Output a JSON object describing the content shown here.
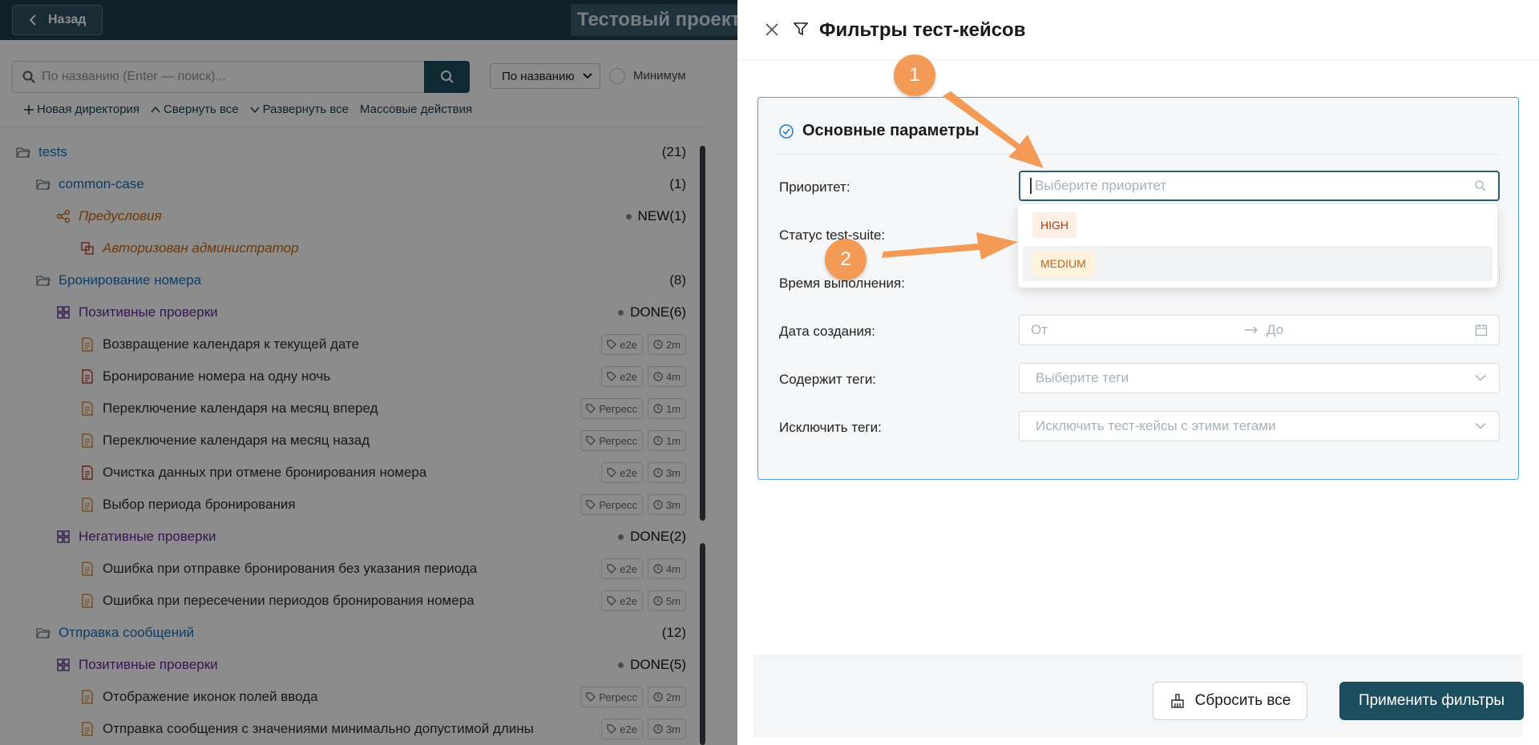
{
  "app": {
    "back_label": "Назад",
    "project_title": "Тестовый проект"
  },
  "search": {
    "placeholder": "По названию (Enter — поиск)...",
    "sort_value": "По названию",
    "min_label": "Минимум"
  },
  "toolbar": {
    "new_dir": "Новая директория",
    "collapse_all": "Свернуть все",
    "expand_all": "Развернуть все",
    "mass_actions": "Массовые действия"
  },
  "tree": {
    "rows": [
      {
        "label": "tests",
        "count": "(21)"
      },
      {
        "label": "common-case",
        "count": "(1)"
      },
      {
        "label": "Предусловия",
        "status": "NEW",
        "count": "(1)"
      },
      {
        "label": "Авторизован администратор"
      },
      {
        "label": "Бронирование номера",
        "count": "(8)"
      },
      {
        "label": "Позитивные проверки",
        "status": "DONE",
        "count": "(6)"
      },
      {
        "label": "Возвращение календаря к текущей дате",
        "tag": "e2e",
        "time": "2m"
      },
      {
        "label": "Бронирование номера на одну ночь",
        "tag": "e2e",
        "time": "4m"
      },
      {
        "label": "Переключение календаря на месяц вперед",
        "tag": "Регресс",
        "time": "1m"
      },
      {
        "label": "Переключение календаря на месяц назад",
        "tag": "Регресс",
        "time": "1m"
      },
      {
        "label": "Очистка данных при отмене бронирования номера",
        "tag": "e2e",
        "time": "3m"
      },
      {
        "label": "Выбор периода бронирования",
        "tag": "Регресс",
        "time": "3m"
      },
      {
        "label": "Негативные проверки",
        "status": "DONE",
        "count": "(2)"
      },
      {
        "label": "Ошибка при отправке бронирования без указания периода",
        "tag": "e2e",
        "time": "4m"
      },
      {
        "label": "Ошибка при пересечении периодов бронирования номера",
        "tag": "e2e",
        "time": "5m"
      },
      {
        "label": "Отправка сообщений",
        "count": "(12)"
      },
      {
        "label": "Позитивные проверки",
        "status": "DONE",
        "count": "(5)"
      },
      {
        "label": "Отображение иконок полей ввода",
        "tag": "Регресс",
        "time": "2m"
      },
      {
        "label": "Отправка сообщения с значениями минимально допустимой длины",
        "tag": "e2e",
        "time": "3m"
      }
    ]
  },
  "drawer": {
    "title": "Фильтры тест-кейсов",
    "section_title": "Основные параметры",
    "priority_label": "Приоритет:",
    "priority_placeholder": "Выберите приоритет",
    "status_label": "Статус test-suite:",
    "duration_label": "Время выполнения:",
    "created_label": "Дата создания:",
    "date_from": "От",
    "date_to": "До",
    "tags_label": "Содержит теги:",
    "tags_placeholder": "Выберите теги",
    "exclude_label": "Исключить теги:",
    "exclude_placeholder": "Исключить тест-кейсы с этими тегами",
    "options": [
      "HIGH",
      "MEDIUM"
    ],
    "reset_label": "Сбросить все",
    "apply_label": "Применить фильтры"
  },
  "annotations": {
    "marker1": "1",
    "marker2": "2"
  },
  "colors": {
    "accent": "#1d4e5f",
    "annotation": "#f29a56",
    "high_tag": "#b23a12",
    "medium_tag": "#b8651a"
  }
}
